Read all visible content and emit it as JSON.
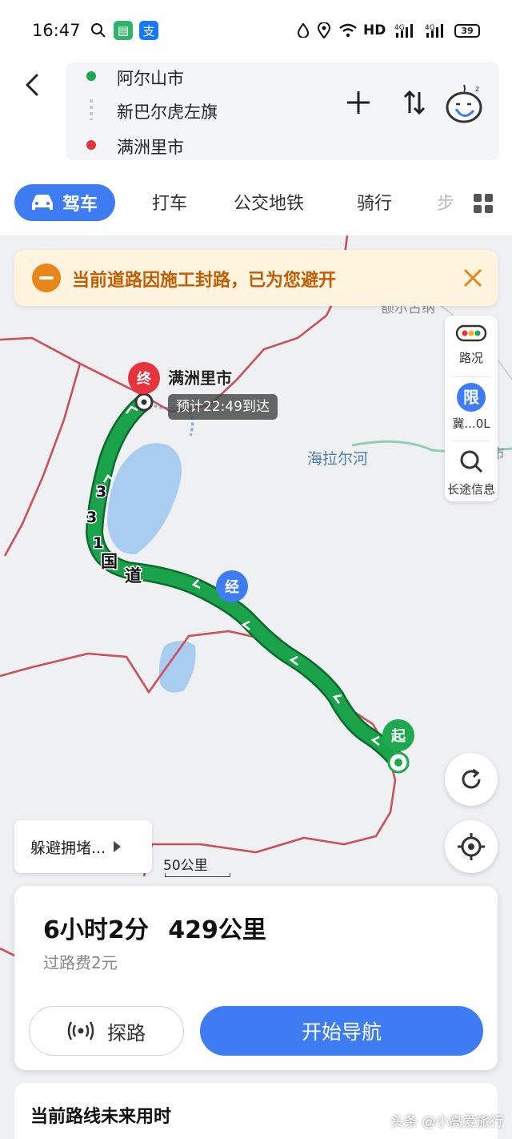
{
  "status_bar": {
    "time": "16:47",
    "network": "HD",
    "battery": "39"
  },
  "route": {
    "origin": "阿尔山市",
    "via": "新巴尔虎左旗",
    "destination": "满洲里市"
  },
  "tabs": [
    {
      "label": "驾车",
      "active": true
    },
    {
      "label": "打车"
    },
    {
      "label": "公交地铁"
    },
    {
      "label": "骑行"
    },
    {
      "label": "步"
    }
  ],
  "notice": {
    "text": "当前道路因施工封路，已为您避开",
    "color": "#c25d06"
  },
  "side_panel": {
    "traffic": "路况",
    "limit_badge": "限",
    "limit_label": "冀...0L",
    "longtrip": "长途信息"
  },
  "map": {
    "destination_city": "满洲里市",
    "eta": "预计22:49到达",
    "river": "海拉尔河",
    "road_name": "331国道",
    "road_chars": [
      "3",
      "3",
      "1",
      "国",
      "道"
    ],
    "faded_right": "市",
    "faded_top": "额尔古纳",
    "pins": {
      "end": "终",
      "start": "起",
      "via": "经"
    },
    "scale": "50公里",
    "avoid_button": "躲避拥堵..."
  },
  "summary": {
    "duration": "6小时2分",
    "distance": "429公里",
    "toll": "过路费2元",
    "explore_button": "探路",
    "navigate_button": "开始导航"
  },
  "future_section": {
    "title": "当前路线未来用时"
  },
  "watermark": "头条 @小高爱旅行",
  "colors": {
    "accent": "#3d7cf2",
    "route_green": "#1aa34a",
    "start_green": "#1ea84f",
    "end_red": "#e6333d",
    "border_red": "#c9525c",
    "notice_orange": "#e8861a"
  }
}
